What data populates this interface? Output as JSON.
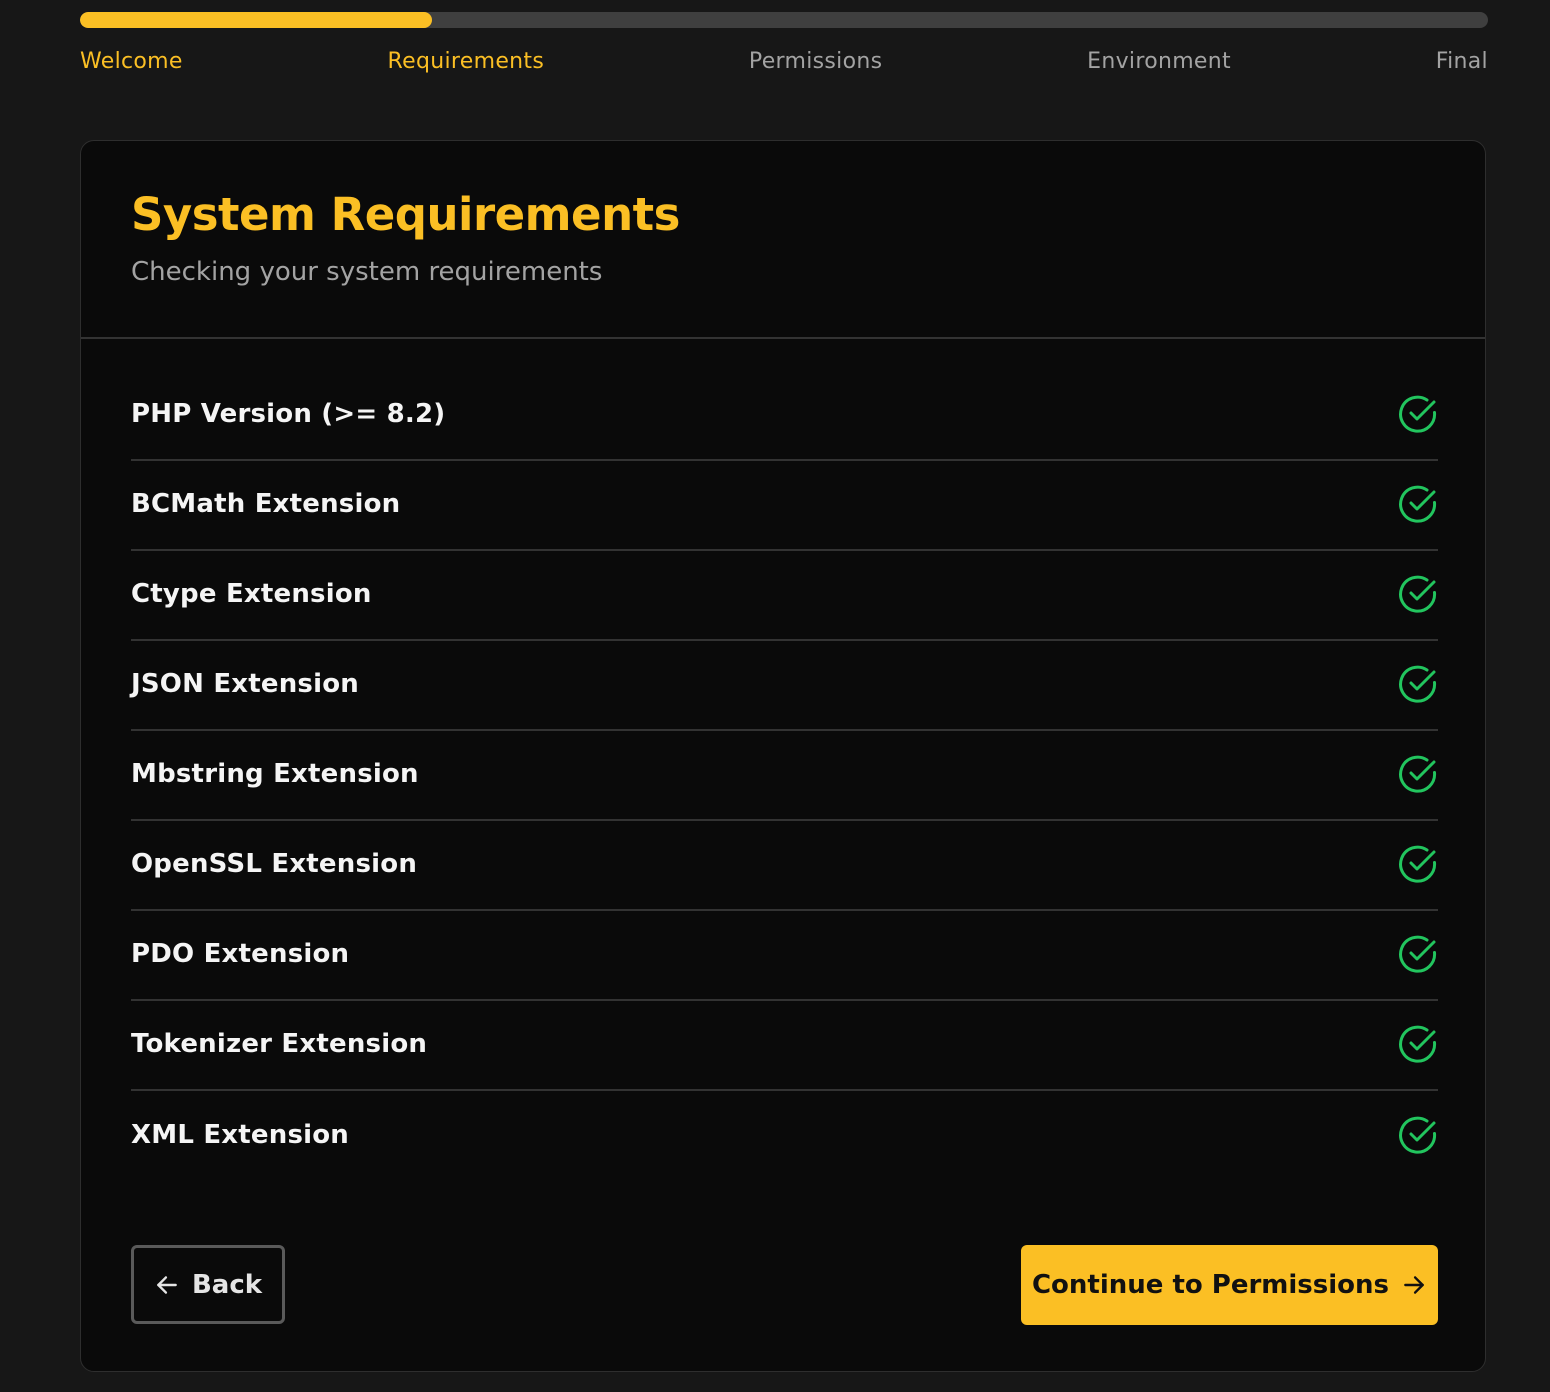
{
  "progress": {
    "fraction": 0.25,
    "color": "#fbbf24"
  },
  "steps": [
    {
      "label": "Welcome",
      "state": "complete"
    },
    {
      "label": "Requirements",
      "state": "active"
    },
    {
      "label": "Permissions",
      "state": "pending"
    },
    {
      "label": "Environment",
      "state": "pending"
    },
    {
      "label": "Final",
      "state": "pending"
    }
  ],
  "header": {
    "title": "System Requirements",
    "subtitle": "Checking your system requirements"
  },
  "requirements": [
    {
      "label": "PHP Version (>= 8.2)",
      "status": "passed",
      "icon": "check-circle-icon"
    },
    {
      "label": "BCMath Extension",
      "status": "passed",
      "icon": "check-circle-icon"
    },
    {
      "label": "Ctype Extension",
      "status": "passed",
      "icon": "check-circle-icon"
    },
    {
      "label": "JSON Extension",
      "status": "passed",
      "icon": "check-circle-icon"
    },
    {
      "label": "Mbstring Extension",
      "status": "passed",
      "icon": "check-circle-icon"
    },
    {
      "label": "OpenSSL Extension",
      "status": "passed",
      "icon": "check-circle-icon"
    },
    {
      "label": "PDO Extension",
      "status": "passed",
      "icon": "check-circle-icon"
    },
    {
      "label": "Tokenizer Extension",
      "status": "passed",
      "icon": "check-circle-icon"
    },
    {
      "label": "XML Extension",
      "status": "passed",
      "icon": "check-circle-icon"
    }
  ],
  "actions": {
    "back_label": "Back",
    "back_icon": "arrow-left-icon",
    "continue_label": "Continue to Permissions",
    "continue_icon": "arrow-right-icon",
    "continue_color": "#fbbf24"
  },
  "colors": {
    "accent": "#fbbf24",
    "success": "#22c55e",
    "background": "#171717",
    "card": "#0a0a0a"
  }
}
